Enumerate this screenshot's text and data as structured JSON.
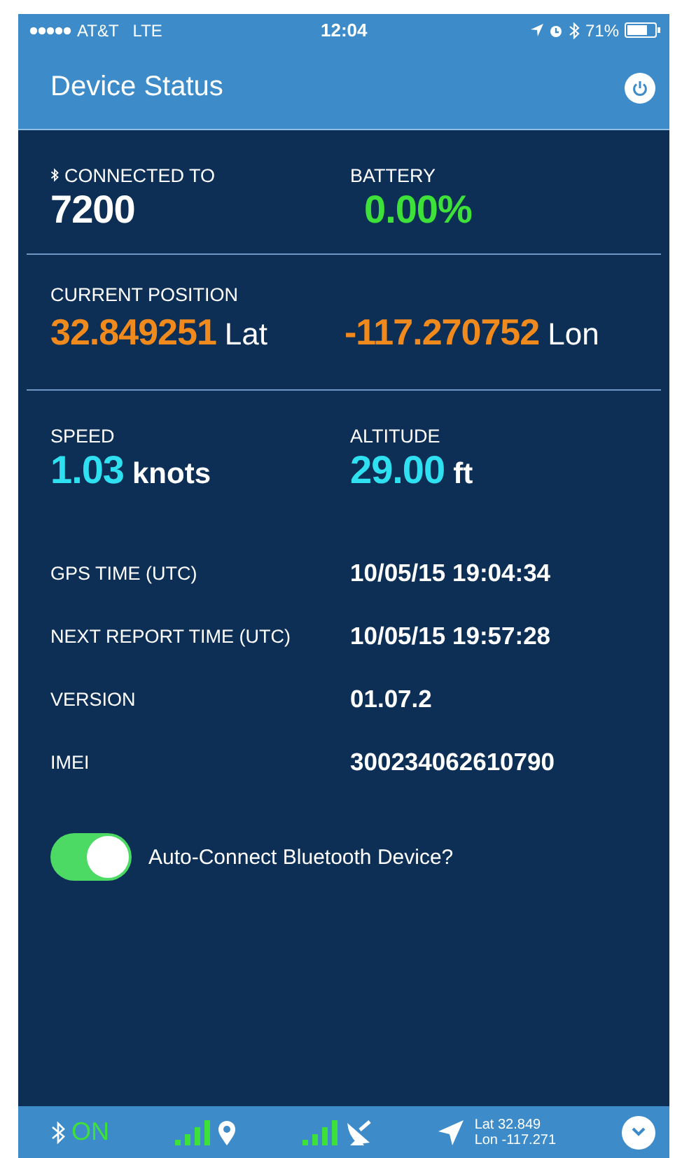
{
  "status_bar": {
    "carrier": "AT&T",
    "network": "LTE",
    "time": "12:04",
    "battery": "71%"
  },
  "header": {
    "title": "Device Status"
  },
  "connection": {
    "label": "CONNECTED TO",
    "value": "7200"
  },
  "battery": {
    "label": "BATTERY",
    "value": "0.00%"
  },
  "position": {
    "label": "CURRENT POSITION",
    "lat": "32.849251",
    "lat_unit": "Lat",
    "lon": "-117.270752",
    "lon_unit": "Lon"
  },
  "speed": {
    "label": "SPEED",
    "value": "1.03",
    "unit": "knots"
  },
  "altitude": {
    "label": "ALTITUDE",
    "value": "29.00",
    "unit": "ft"
  },
  "info_rows": [
    {
      "label": "GPS TIME (UTC)",
      "value": "10/05/15 19:04:34"
    },
    {
      "label": "NEXT REPORT TIME (UTC)",
      "value": "10/05/15 19:57:28"
    },
    {
      "label": "VERSION",
      "value": "01.07.2"
    },
    {
      "label": "IMEI",
      "value": "300234062610790"
    }
  ],
  "auto_connect": {
    "label": "Auto-Connect Bluetooth Device?",
    "on": true
  },
  "bottom_bar": {
    "bluetooth": "ON",
    "lat": "Lat 32.849",
    "lon": "Lon -117.271"
  }
}
